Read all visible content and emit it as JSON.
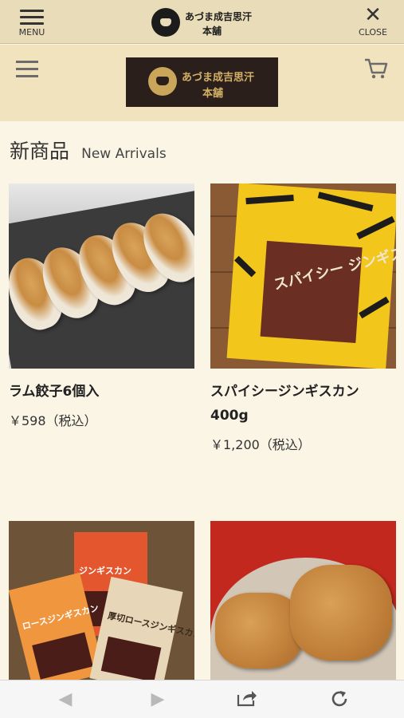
{
  "topbar": {
    "menu_label": "MENU",
    "close_label": "CLOSE",
    "logo_line1": "あづま成吉思汗",
    "logo_line2": "本舗"
  },
  "header": {
    "brand_line1": "あづま成吉思汗",
    "brand_line2": "本舗"
  },
  "section": {
    "title_jp": "新商品",
    "title_en": "New Arrivals"
  },
  "products": [
    {
      "name": "ラム餃子6個入",
      "price": "￥598（税込）"
    },
    {
      "name": "スパイシージンギスカン　400g",
      "price": "￥1,200（税込）",
      "image_text": "スパイシー ジンギスカン"
    },
    {
      "name": "",
      "price": "",
      "image_text": [
        "ジンギスカン",
        "ロースジンギスカン",
        "厚切ロースジンギスカン"
      ]
    },
    {
      "name": "",
      "price": ""
    }
  ],
  "icons": {
    "menu": "hamburger-icon",
    "close": "close-icon",
    "cart": "cart-icon",
    "back": "back-arrow-icon",
    "forward": "forward-arrow-icon",
    "share": "share-icon",
    "reload": "reload-icon"
  },
  "colors": {
    "topbar": "#e9dcb8",
    "header": "#f1e3bd",
    "page": "#fbf5e6",
    "brand_box": "#2a1f1a",
    "brand_text": "#d2b067"
  }
}
